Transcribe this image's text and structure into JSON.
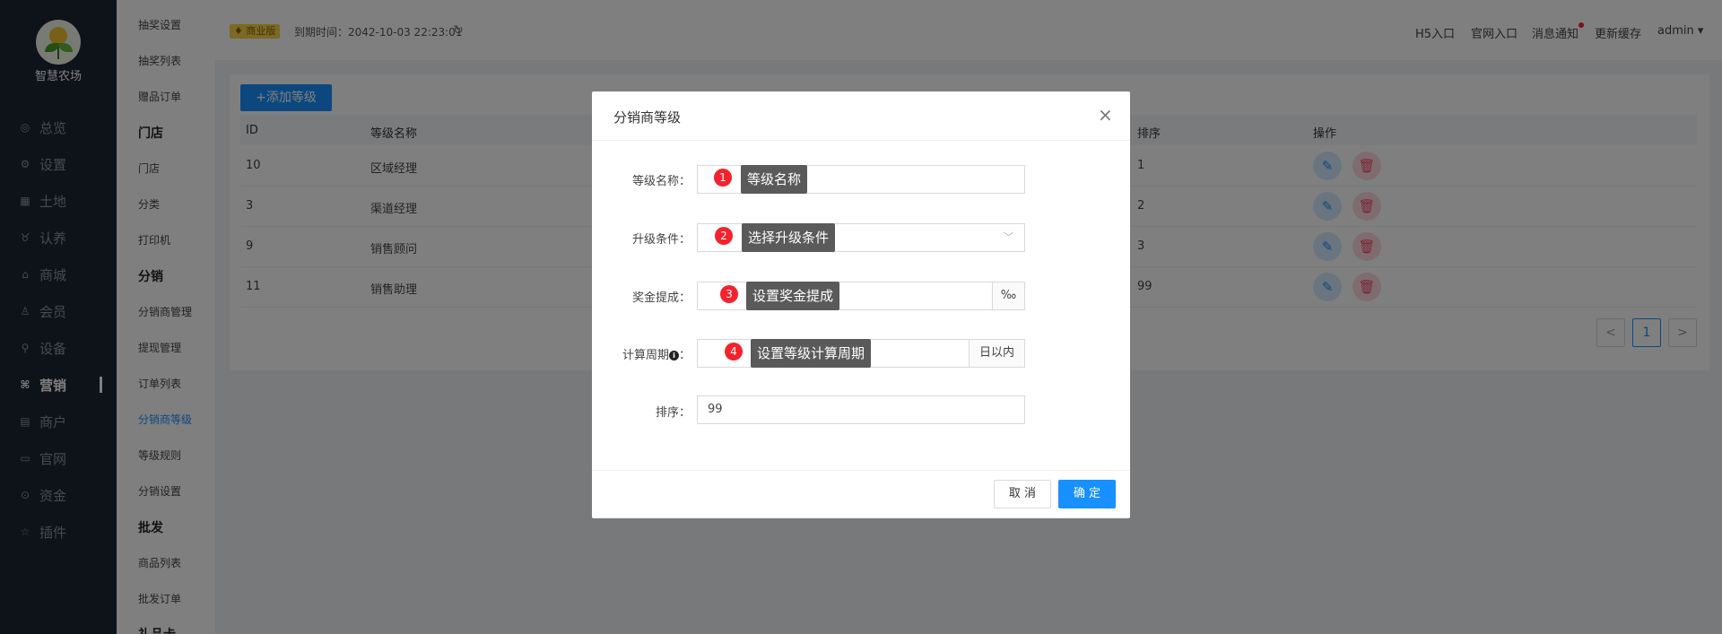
{
  "brand": {
    "name": "智慧农场"
  },
  "nav": [
    {
      "label": "总览",
      "icon": "dashboard-icon",
      "glyph": "◎"
    },
    {
      "label": "设置",
      "icon": "gear-icon",
      "glyph": "⚙"
    },
    {
      "label": "土地",
      "icon": "grid-icon",
      "glyph": "▦"
    },
    {
      "label": "认养",
      "icon": "adopt-icon",
      "glyph": "♉"
    },
    {
      "label": "商城",
      "icon": "store-icon",
      "glyph": "⌂"
    },
    {
      "label": "会员",
      "icon": "member-icon",
      "glyph": "♙"
    },
    {
      "label": "设备",
      "icon": "device-icon",
      "glyph": "⚲"
    },
    {
      "label": "营销",
      "icon": "marketing-icon",
      "glyph": "⌘"
    },
    {
      "label": "商户",
      "icon": "merchant-icon",
      "glyph": "▤"
    },
    {
      "label": "官网",
      "icon": "website-icon",
      "glyph": "▭"
    },
    {
      "label": "资金",
      "icon": "fund-icon",
      "glyph": "⊙"
    },
    {
      "label": "插件",
      "icon": "plugin-icon",
      "glyph": "☆"
    }
  ],
  "submenu": [
    {
      "label": "抽奖设置"
    },
    {
      "label": "抽奖列表"
    },
    {
      "label": "赠品订单"
    },
    {
      "label": "门店",
      "head": true
    },
    {
      "label": "门店"
    },
    {
      "label": "分类"
    },
    {
      "label": "打印机"
    },
    {
      "label": "分销",
      "head": true
    },
    {
      "label": "分销商管理"
    },
    {
      "label": "提现管理"
    },
    {
      "label": "订单列表"
    },
    {
      "label": "分销商等级",
      "active": true
    },
    {
      "label": "等级规则"
    },
    {
      "label": "分销设置"
    },
    {
      "label": "批发",
      "head": true
    },
    {
      "label": "商品列表"
    },
    {
      "label": "批发订单"
    },
    {
      "label": "礼品卡",
      "head": true
    }
  ],
  "header": {
    "badge": "商业版",
    "expire": "到期时间：2042-10-03 22:23:01",
    "links": [
      "H5入口",
      "官网入口",
      "消息通知",
      "更新缓存",
      "admin ▾"
    ]
  },
  "list": {
    "add_label": "+添加等级",
    "columns": [
      "ID",
      "等级名称",
      "排序",
      "操作"
    ],
    "rows": [
      {
        "id": "10",
        "name": "区域经理",
        "sort": "1"
      },
      {
        "id": "3",
        "name": "渠道经理",
        "sort": "2"
      },
      {
        "id": "9",
        "name": "销售顾问",
        "sort": "3"
      },
      {
        "id": "11",
        "name": "销售助理",
        "sort": "99"
      }
    ],
    "pagination": {
      "prev": "<",
      "current": "1",
      "next": ">"
    }
  },
  "modal": {
    "title": "分销商等级",
    "close": "×",
    "fields": {
      "name": {
        "label": "等级名称：",
        "tip": "等级名称",
        "num": "1"
      },
      "condition": {
        "label": "升级条件：",
        "tip": "选择升级条件",
        "num": "2",
        "chevron": "﹀"
      },
      "bonus": {
        "label": "奖金提成：",
        "tip": "设置奖金提成",
        "num": "3",
        "suffix": "‰"
      },
      "period": {
        "label": "计算周期",
        "info": "i",
        "colon": "：",
        "tip": "设置等级计算周期",
        "num": "4",
        "suffix": "日以内"
      },
      "sort": {
        "label": "排序：",
        "value": "99"
      }
    },
    "cancel_label": "取 消",
    "ok_label": "确 定"
  },
  "colors": {
    "primary": "#1890ff",
    "danger": "#f5222d",
    "nav_bg": "#1c2533",
    "tip_bg": "#5a5a5a"
  }
}
